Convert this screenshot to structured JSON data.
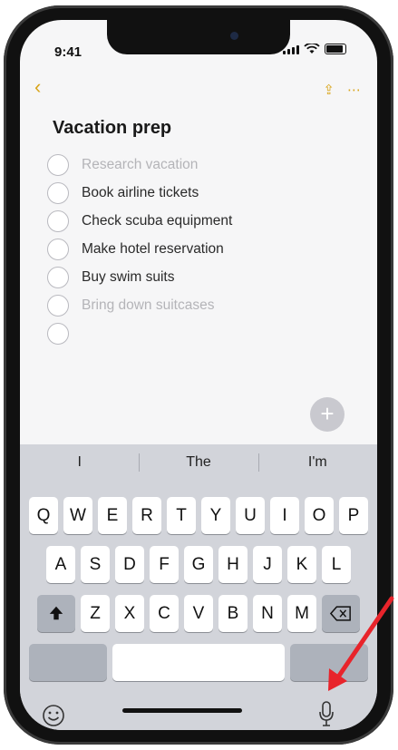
{
  "status": {
    "time": "9:41"
  },
  "note": {
    "title": "Vacation prep",
    "items": [
      {
        "text": "Research vacation",
        "faded": true
      },
      {
        "text": "Book airline tickets",
        "faded": false
      },
      {
        "text": "Check scuba equipment",
        "faded": false
      },
      {
        "text": "Make hotel reservation",
        "faded": false
      },
      {
        "text": "Buy swim suits",
        "faded": false
      },
      {
        "text": "Bring down suitcases",
        "faded": true
      },
      {
        "text": "",
        "faded": false
      }
    ]
  },
  "keyboard": {
    "suggestions": [
      "I",
      "The",
      "I'm"
    ],
    "row1": [
      "Q",
      "W",
      "E",
      "R",
      "T",
      "Y",
      "U",
      "I",
      "O",
      "P"
    ],
    "row2": [
      "A",
      "S",
      "D",
      "F",
      "G",
      "H",
      "J",
      "K",
      "L"
    ],
    "row3": [
      "Z",
      "X",
      "C",
      "V",
      "B",
      "N",
      "M"
    ],
    "shift_icon": "shift-arrow-icon",
    "delete_icon": "backspace-icon",
    "emoji_icon": "emoji-icon",
    "mic_icon": "microphone-icon"
  },
  "colors": {
    "accent": "#d9a51a",
    "arrow": "#e8242b"
  }
}
